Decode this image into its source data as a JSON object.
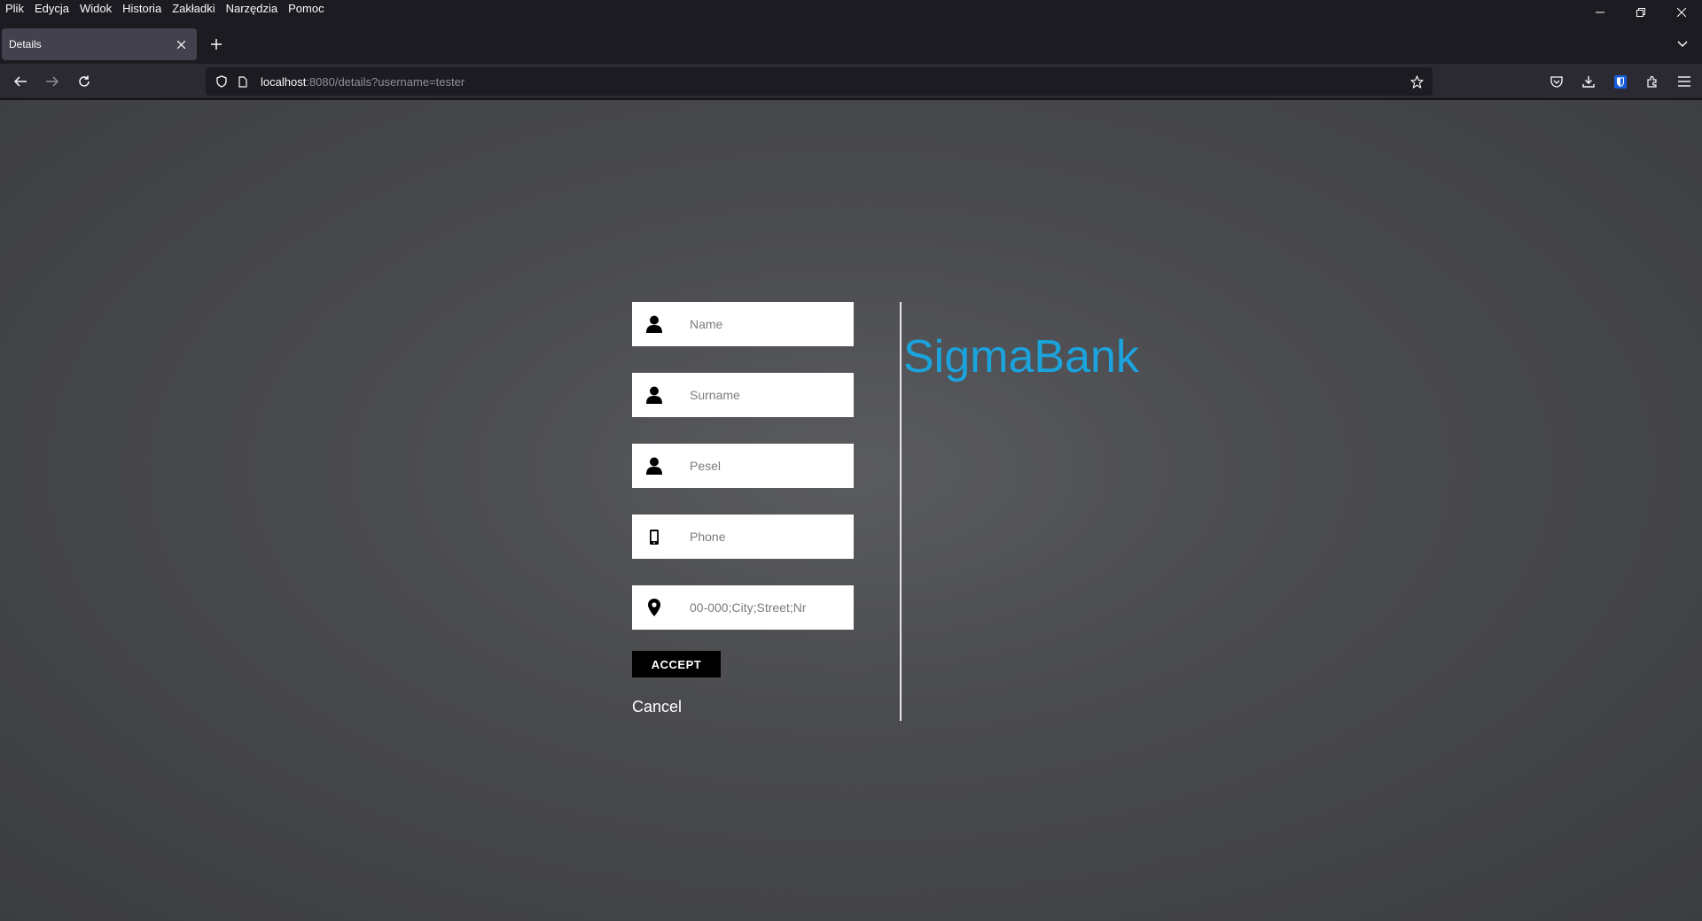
{
  "menu": [
    "Plik",
    "Edycja",
    "Widok",
    "Historia",
    "Zakładki",
    "Narzędzia",
    "Pomoc"
  ],
  "tab": {
    "title": "Details"
  },
  "url": {
    "host": "localhost",
    "rest": ":8080/details?username=tester"
  },
  "form": {
    "name_placeholder": "Name",
    "surname_placeholder": "Surname",
    "pesel_placeholder": "Pesel",
    "phone_placeholder": "Phone",
    "address_placeholder": "00-000;City;Street;Nr",
    "accept_label": "ACCEPT",
    "cancel_label": "Cancel"
  },
  "brand": {
    "name": "SigmaBank",
    "color": "#1ba3dd"
  },
  "icons": {
    "name": "user-icon",
    "surname": "user-icon",
    "pesel": "user-icon",
    "phone": "mobile-phone-icon",
    "address": "map-pin-icon"
  }
}
